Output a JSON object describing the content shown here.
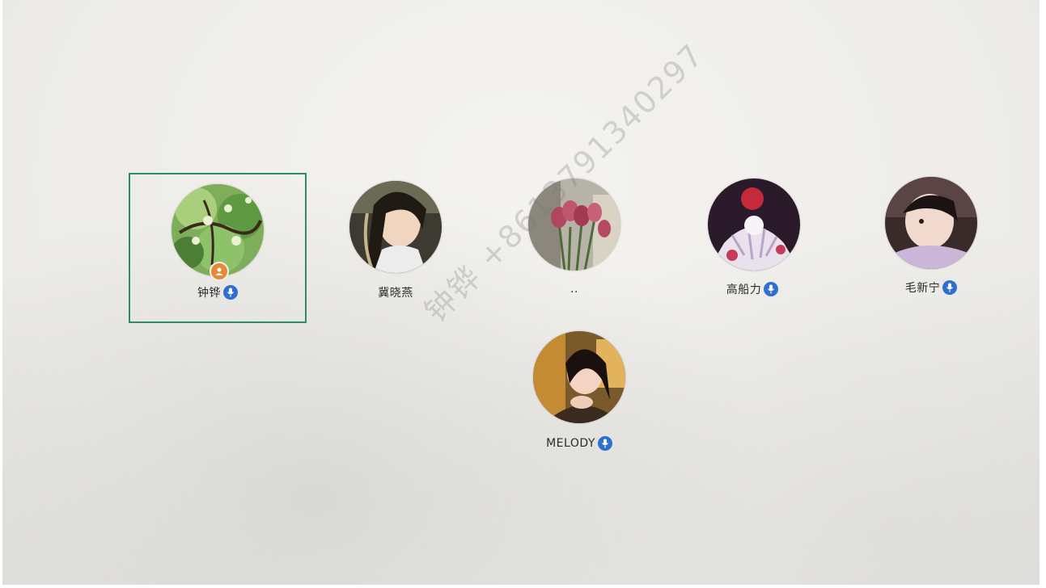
{
  "participants": [
    {
      "name": "钟铧",
      "mic_on": true,
      "is_host": true,
      "selected": true
    },
    {
      "name": "冀晓燕",
      "mic_on": false,
      "is_host": false,
      "selected": false
    },
    {
      "name": "..",
      "mic_on": false,
      "is_host": false,
      "selected": false
    },
    {
      "name": "高船力",
      "mic_on": true,
      "is_host": false,
      "selected": false
    },
    {
      "name": "毛新宁",
      "mic_on": true,
      "is_host": false,
      "selected": false
    },
    {
      "name": "MELODY",
      "mic_on": true,
      "is_host": false,
      "selected": false
    }
  ],
  "watermark": "钟铧 +8613791340297",
  "icons": {
    "mic": "microphone-icon",
    "host": "host-user-icon"
  },
  "colors": {
    "selection_border": "#2f8a6d",
    "mic_badge": "#2f6fd0",
    "host_badge": "#e7893a"
  }
}
